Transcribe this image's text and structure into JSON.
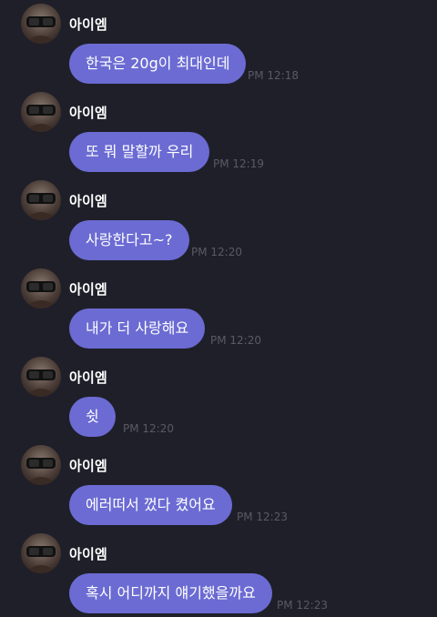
{
  "chat": {
    "messages": [
      {
        "sender": "아이엠",
        "text": "한국은 20g이 최대인데",
        "time": "PM 12:18"
      },
      {
        "sender": "아이엠",
        "text": "또 뭐 말할까 우리",
        "time": "PM 12:19"
      },
      {
        "sender": "아이엠",
        "text": "사랑한다고~?",
        "time": "PM 12:20"
      },
      {
        "sender": "아이엠",
        "text": "내가 더 사랑해요",
        "time": "PM 12:20"
      },
      {
        "sender": "아이엠",
        "text": "쉿",
        "time": "PM 12:20"
      },
      {
        "sender": "아이엠",
        "text": "에러떠서 껐다 켰어요",
        "time": "PM 12:23"
      },
      {
        "sender": "아이엠",
        "text": "혹시 어디까지 얘기했을까요",
        "time": "PM 12:23"
      }
    ]
  },
  "colors": {
    "background": "#1f1f29",
    "bubble": "#6b6bd3",
    "timestamp": "#5a5a66",
    "sender_name": "#ffffff"
  }
}
